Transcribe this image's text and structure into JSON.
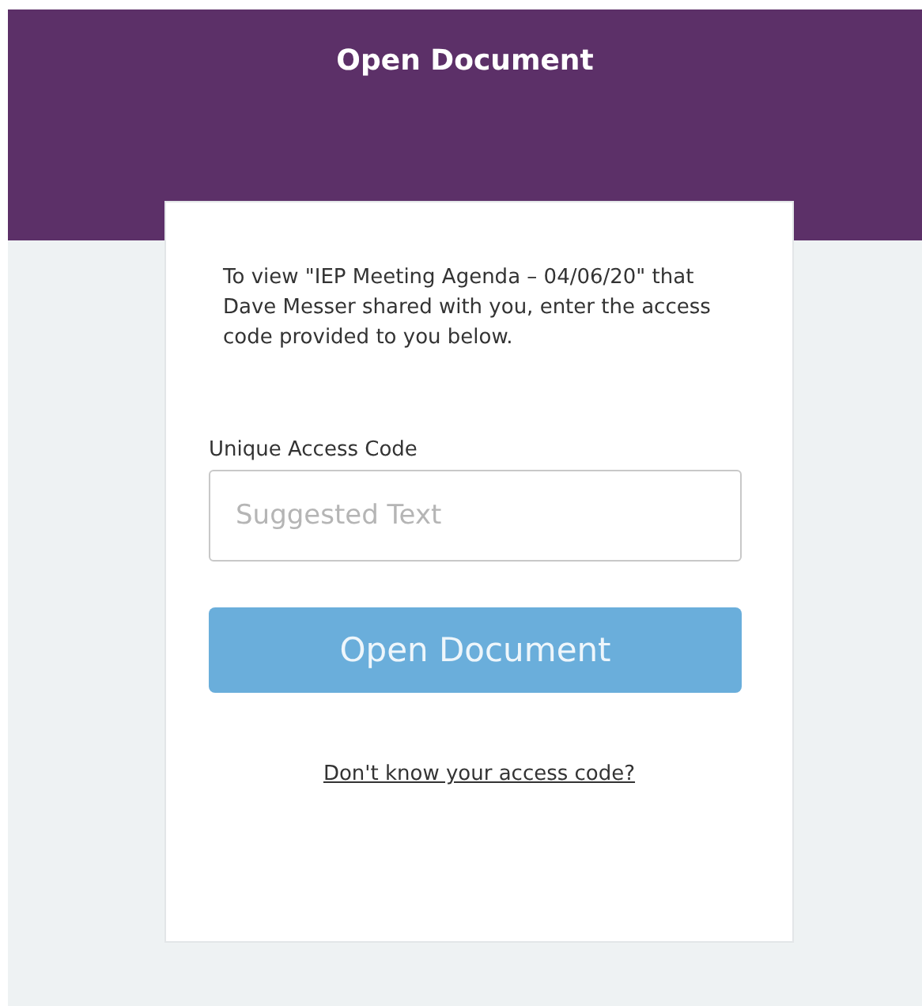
{
  "header": {
    "title": "Open Document"
  },
  "card": {
    "message": "To view \"IEP Meeting Agenda – 04/06/20\" that Dave Messer shared with you, enter the access code provided to you below.",
    "field": {
      "label": "Unique Access Code",
      "placeholder": "Suggested Text"
    },
    "button": "Open Document",
    "link": "Don't know your access code?"
  }
}
